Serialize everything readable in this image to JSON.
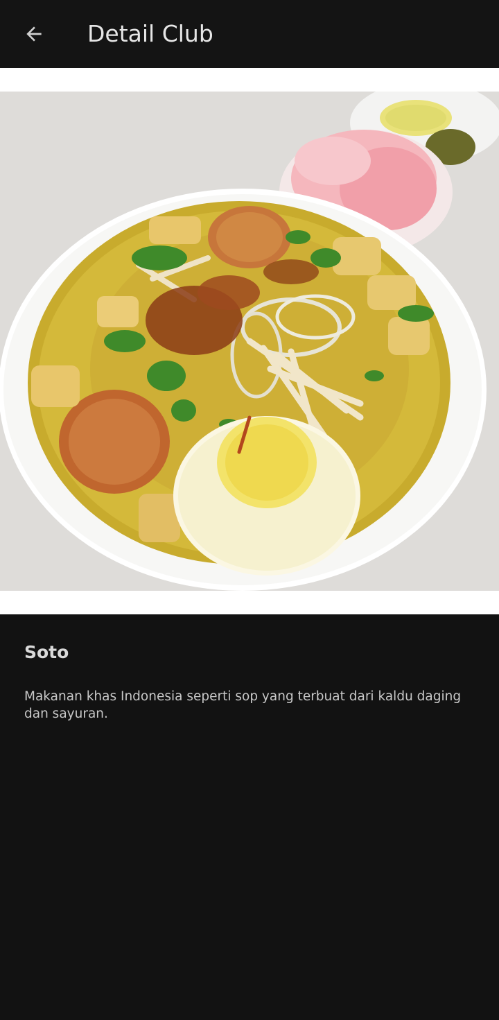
{
  "app_bar": {
    "title": "Detail Club",
    "back_icon": "arrow-left-icon"
  },
  "detail": {
    "image_alt": "soto-bowl-photo",
    "name": "Soto",
    "description": "Makanan khas Indonesia seperti sop yang terbuat dari kaldu daging dan sayuran."
  },
  "colors": {
    "background": "#121212",
    "app_bar": "#141414",
    "title_text": "#e6e6e6",
    "body_text": "#c8c8c8"
  }
}
